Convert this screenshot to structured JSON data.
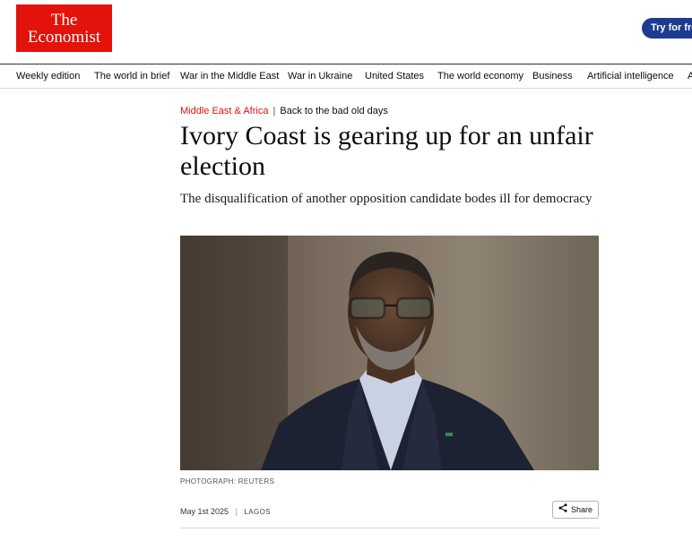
{
  "brand": {
    "line1": "The",
    "line2": "Economist"
  },
  "header": {
    "cta_label": "Try for free"
  },
  "nav": {
    "items": [
      "Weekly edition",
      "The world in brief",
      "War in the Middle East",
      "War in Ukraine",
      "United States",
      "The world economy",
      "Business",
      "Artificial intelligence",
      "A"
    ]
  },
  "article": {
    "section": "Middle East & Africa",
    "separator": "|",
    "fly_title": "Back to the bad old days",
    "headline": "Ivory Coast is gearing up for an unfair election",
    "subheadline": "The disqualification of another opposition candidate bodes ill for democracy",
    "image_credit": "PHOTOGRAPH: REUTERS",
    "date": "May 1st 2025",
    "meta_separator": "|",
    "location": "LAGOS",
    "share_label": "Share"
  },
  "colors": {
    "brand_red": "#e3120b",
    "cta_blue": "#1d3c8f"
  }
}
